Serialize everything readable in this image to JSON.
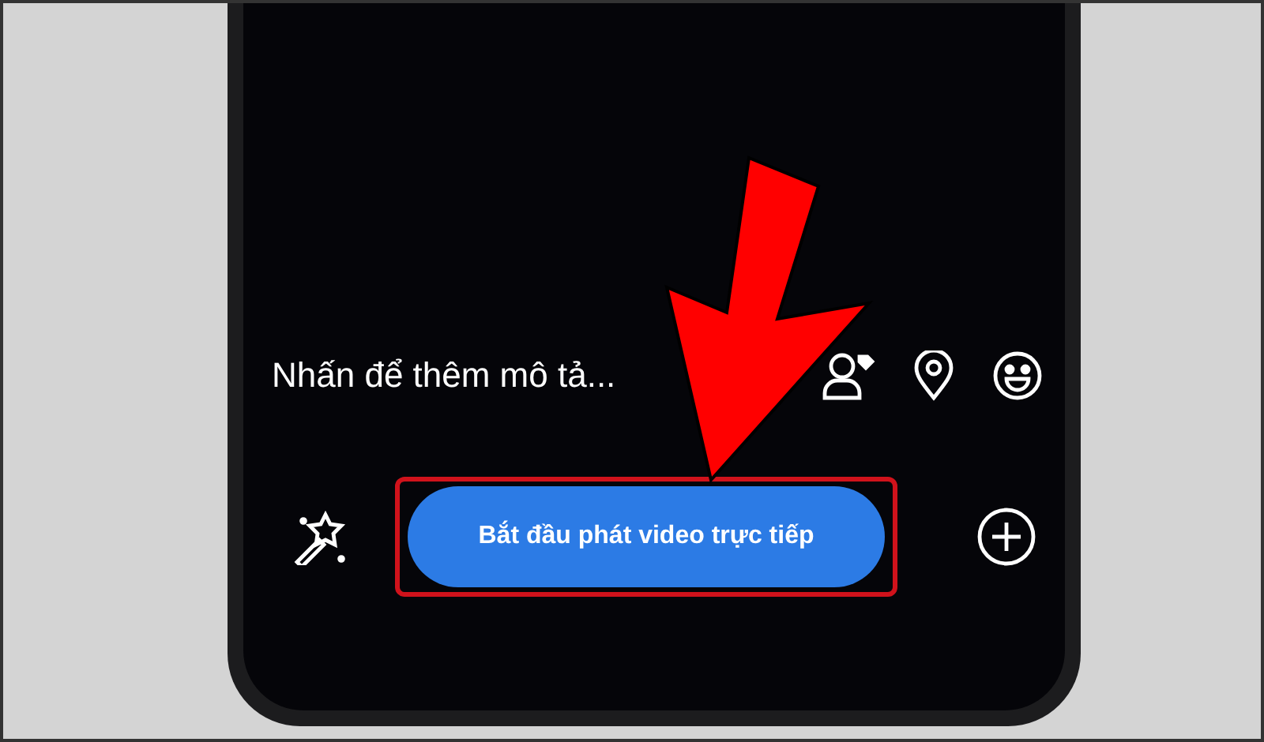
{
  "caption_field": {
    "placeholder": "Nhấn để thêm mô tả..."
  },
  "primary_button": {
    "label": "Bắt đầu phát video trực tiếp"
  }
}
